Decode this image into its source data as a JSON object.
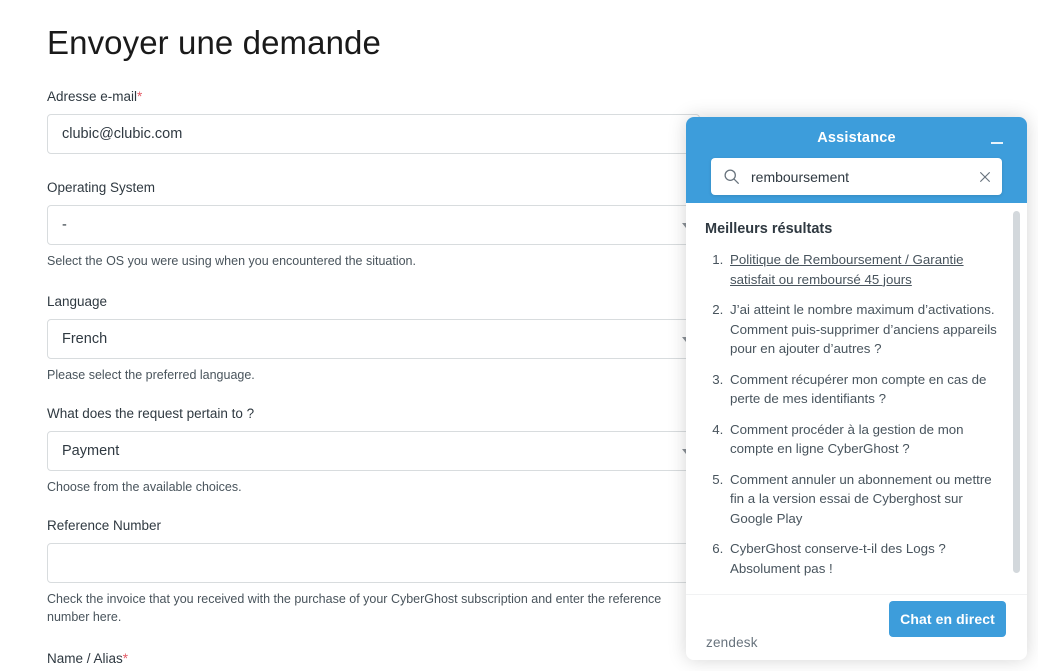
{
  "page": {
    "title": "Envoyer une demande"
  },
  "form": {
    "fields": [
      {
        "label": "Adresse e-mail",
        "required": true,
        "value": "clubic@clubic.com",
        "hint": "",
        "type": "text"
      },
      {
        "label": "Operating System",
        "required": false,
        "value": "-",
        "hint": "Select the OS you were using when you encountered the situation.",
        "type": "select"
      },
      {
        "label": "Language",
        "required": false,
        "value": "French",
        "hint": "Please select the preferred language.",
        "type": "select"
      },
      {
        "label": "What does the request pertain to ?",
        "required": false,
        "value": "Payment",
        "hint": "Choose from the available choices.",
        "type": "select"
      },
      {
        "label": "Reference Number",
        "required": false,
        "value": "",
        "hint": "Check the invoice that you received with the purchase of your CyberGhost subscription and enter the reference number here.",
        "type": "text"
      },
      {
        "label": "Name / Alias",
        "required": true,
        "value": "",
        "hint": "",
        "type": "text"
      }
    ],
    "required_marker": "*"
  },
  "widget": {
    "header_title": "Assistance",
    "minimize_label": "−",
    "accent_color": "#3d9ddb",
    "search": {
      "value": "remboursement",
      "placeholder": "Recherche",
      "search_icon": "search-icon",
      "clear_icon": "close-icon"
    },
    "results_title": "Meilleurs résultats",
    "results": [
      "Politique de Remboursement / Garantie satisfait ou remboursé 45 jours",
      "J’ai atteint le nombre maximum d’activations. Comment puis-supprimer d’anciens appareils pour en ajouter d’autres ?",
      "Comment récupérer mon compte en cas de perte de mes identifiants ?",
      "Comment procéder à la gestion de mon compte en ligne CyberGhost ?",
      "Comment annuler un abonnement ou mettre fin a la version essai de Cyberghost sur Google Play",
      "CyberGhost conserve-t-il des Logs ? Absolument pas !"
    ],
    "footer": {
      "brand": "zendesk",
      "chat_button": "Chat en direct"
    }
  }
}
